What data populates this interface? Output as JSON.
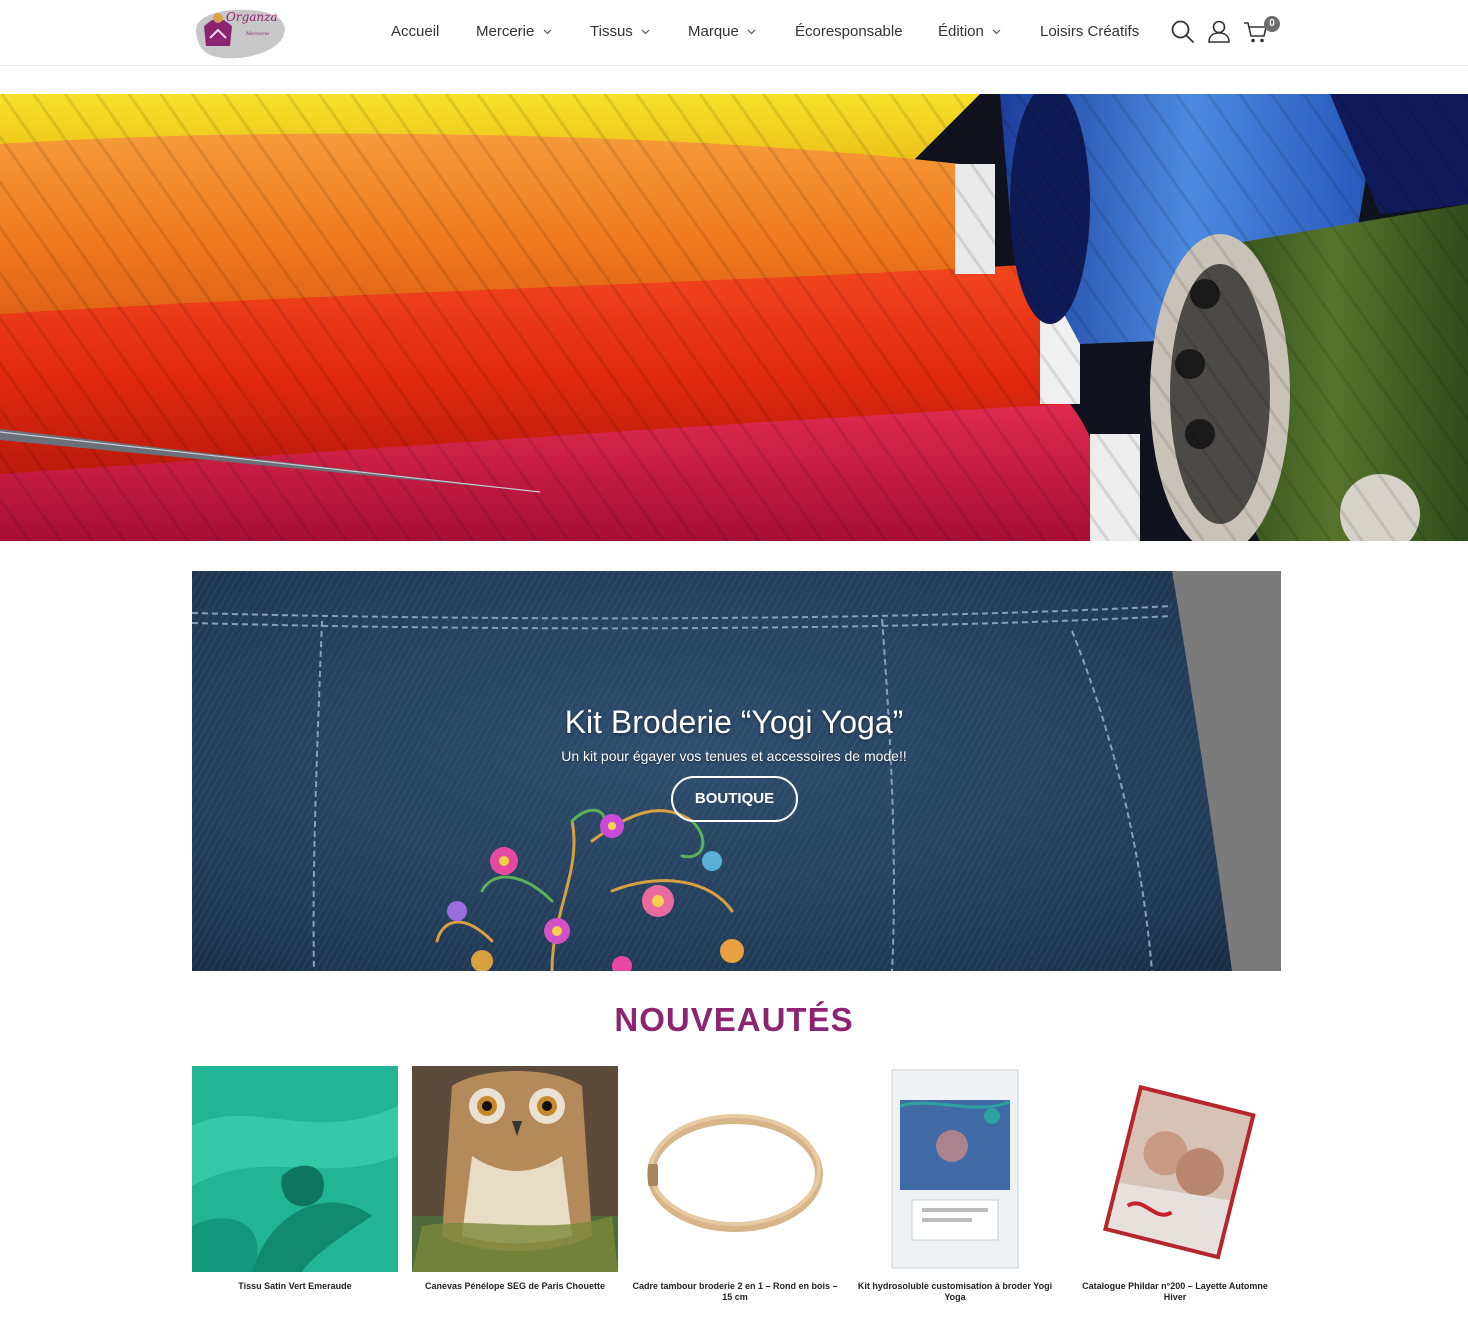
{
  "header": {
    "logo": {
      "text_line1": "Organza",
      "text_line2": "Mercerie"
    },
    "nav": [
      {
        "label": "Accueil",
        "has_dropdown": false
      },
      {
        "label": "Mercerie",
        "has_dropdown": true
      },
      {
        "label": "Tissus",
        "has_dropdown": true
      },
      {
        "label": "Marque",
        "has_dropdown": true
      },
      {
        "label": "Écoresponsable",
        "has_dropdown": false
      },
      {
        "label": "Édition",
        "has_dropdown": true
      },
      {
        "label": "Loisirs Créatifs",
        "has_dropdown": false
      }
    ],
    "icons": [
      "search-icon",
      "user-icon",
      "cart-icon"
    ],
    "cart_count": "0"
  },
  "promo": {
    "title": "Kit Broderie “Yogi Yoga”",
    "subtitle": "Un kit pour égayer vos tenues et accessoires de mode!!",
    "button_label": "BOUTIQUE"
  },
  "new_items": {
    "title": "NOUVEAUTÉS",
    "products": [
      {
        "name": "Tissu Satin Vert Emeraude"
      },
      {
        "name": "Canevas Pénélope SEG de Paris Chouette"
      },
      {
        "name": "Cadre tambour broderie 2 en 1 – Rond en bois – 15 cm"
      },
      {
        "name": "Kit hydrosoluble customisation à broder Yogi Yoga"
      },
      {
        "name": "Catalogue Phildar n°200 – Layette Automne Hiver"
      }
    ]
  },
  "colors": {
    "accent": "#8c2571",
    "denim": "#2a4661",
    "satin": "#21b596"
  }
}
